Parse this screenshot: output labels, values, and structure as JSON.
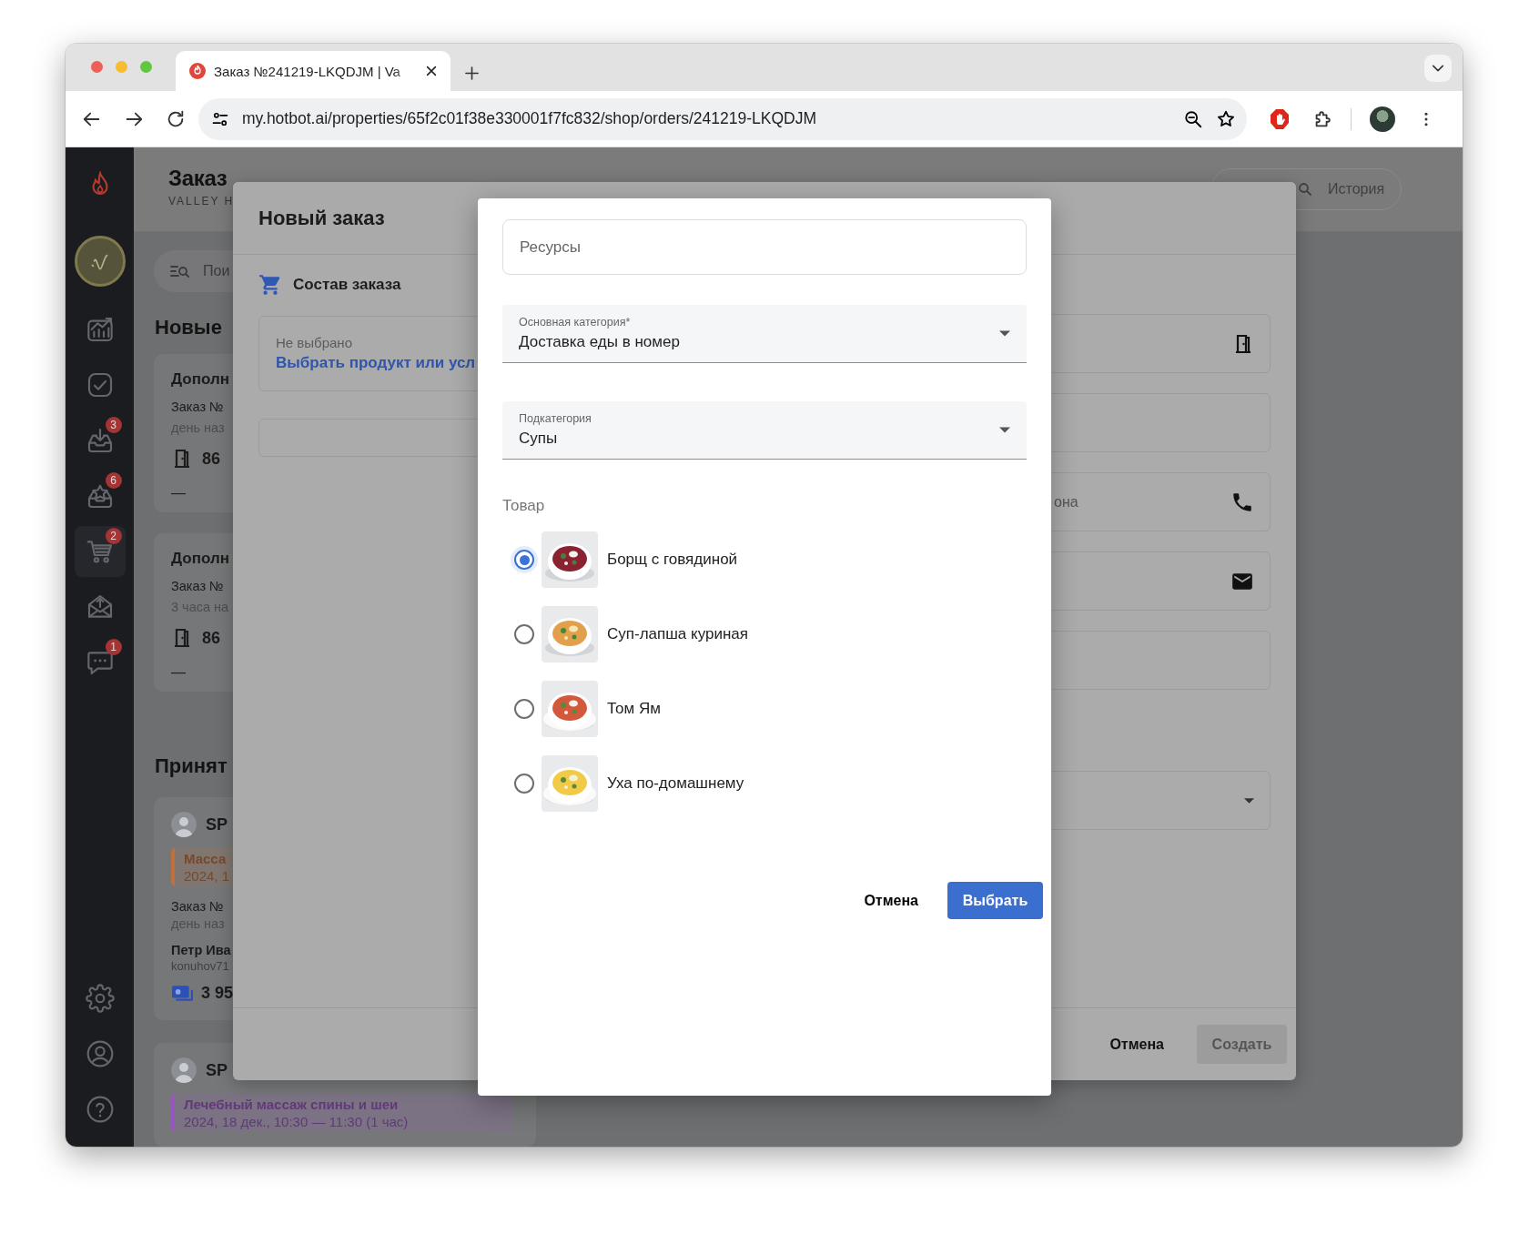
{
  "browser": {
    "tab": {
      "title": "Заказ №241219-LKQDJM | Va",
      "selected": true
    },
    "url": "my.hotbot.ai/properties/65f2c01f38e330001f7fc832/shop/orders/241219-LKQDJM"
  },
  "sidebar": {
    "items": [
      {
        "kind": "chart",
        "selected": false
      },
      {
        "kind": "check",
        "selected": false
      },
      {
        "kind": "inbox-down",
        "badge": "3",
        "selected": false
      },
      {
        "kind": "inbox-star",
        "badge": "6",
        "selected": false
      },
      {
        "kind": "cart",
        "badge": "2",
        "selected": true
      },
      {
        "kind": "mail-up",
        "selected": false
      },
      {
        "kind": "chat",
        "badge": "1",
        "selected": false
      }
    ],
    "bottom_items": [
      {
        "kind": "settings",
        "selected": false
      },
      {
        "kind": "user",
        "selected": false
      },
      {
        "kind": "help",
        "selected": false
      }
    ]
  },
  "page": {
    "title": "Заказ",
    "subtitle": "VALLEY H",
    "history_button": "История",
    "search_placeholder": "Пои",
    "sections": [
      {
        "title": "Новые",
        "cards": [
          {
            "kind": "request",
            "title": "Дополн",
            "order": "Заказ №",
            "time": "день наз",
            "room": "86",
            "note": "—"
          },
          {
            "kind": "request",
            "title": "Дополн",
            "order": "Заказ №",
            "time": "3 часа на",
            "room": "86",
            "note": "—"
          }
        ]
      },
      {
        "title": "Принят",
        "cards": [
          {
            "kind": "booking",
            "service": "SP",
            "tag": {
              "title": "Масса",
              "date": "2024, 1",
              "color": "#c2703a"
            },
            "order": "Заказ №",
            "time": "день наз",
            "guest": "Петр Ива",
            "email": "konuhov71",
            "amount": "3 95"
          },
          {
            "kind": "booking",
            "service": "SP",
            "tag": {
              "title": "Лечебный массаж спины и шеи",
              "date": "2024, 18 дек., 10:30 — 11:30  (1 час)",
              "color": "#9a55c4"
            }
          }
        ]
      }
    ]
  },
  "order_dialog": {
    "title": "Новый заказ",
    "section": "Состав заказа",
    "product": {
      "status": "Не выбрано",
      "link": "Выбрать продукт или усл"
    },
    "fields": [
      {
        "kind": "room"
      },
      {
        "kind": "text"
      },
      {
        "kind": "phone",
        "placeholder": "она"
      },
      {
        "kind": "email"
      },
      {
        "kind": "text"
      },
      {
        "kind": "select"
      }
    ],
    "buttons": {
      "cancel": "Отмена",
      "create": {
        "label": "Создать",
        "disabled": true
      }
    }
  },
  "picker": {
    "search": {
      "placeholder": "Ресурсы"
    },
    "category": {
      "label": "Основная категория*",
      "value": "Доставка еды в номер"
    },
    "subcategory": {
      "label": "Подкатегория",
      "value": "Супы"
    },
    "products_label": "Товар",
    "products": [
      {
        "name": "Борщ с говядиной",
        "selected": true
      },
      {
        "name": "Суп-лапша куриная",
        "selected": false
      },
      {
        "name": "Том Ям",
        "selected": false
      },
      {
        "name": "Уха по-домашнему",
        "selected": false
      }
    ],
    "buttons": {
      "cancel": "Отмена",
      "confirm": "Выбрать"
    }
  }
}
